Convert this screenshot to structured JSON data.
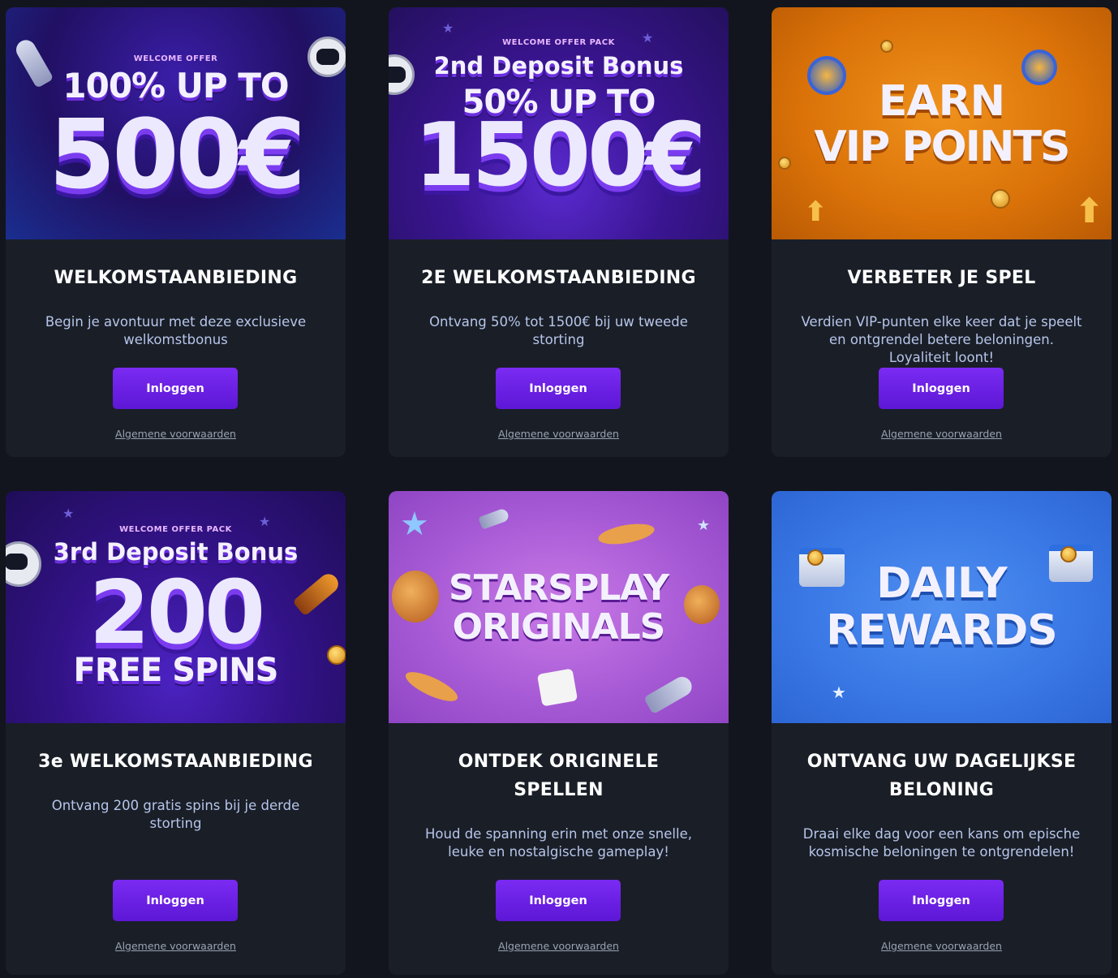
{
  "login_label": "Inloggen",
  "terms_label": "Algemene voorwaarden",
  "cards": [
    {
      "title": "WELKOMSTAANBIEDING",
      "description": "Begin je avontuur met deze exclusieve welkomstbonus",
      "banner": {
        "kicker": "WELCOME OFFER",
        "line1": "100% UP TO",
        "big": "500€"
      }
    },
    {
      "title": "2E WELKOMSTAANBIEDING",
      "description": "Ontvang 50% tot 1500€ bij uw tweede storting",
      "banner": {
        "kicker": "WELCOME OFFER PACK",
        "deposit": "2nd Deposit Bonus",
        "line1": "50% UP TO",
        "big": "1500€"
      }
    },
    {
      "title": "VERBETER JE SPEL",
      "description": "Verdien VIP-punten elke keer dat je speelt en ontgrendel betere beloningen. Loyaliteit loont!",
      "banner": {
        "line1": "EARN",
        "line2": "VIP POINTS"
      }
    },
    {
      "title": "3e WELKOMSTAANBIEDING",
      "description": "Ontvang 200 gratis spins bij je derde storting",
      "banner": {
        "kicker": "WELCOME OFFER PACK",
        "deposit": "3rd Deposit Bonus",
        "big": "200",
        "line2": "FREE SPINS"
      }
    },
    {
      "title": "ONTDEK ORIGINELE SPELLEN",
      "description": "Houd de spanning erin met onze snelle, leuke en nostalgische gameplay!",
      "banner": {
        "line1": "STARSPLAY",
        "line2": "ORIGINALS"
      }
    },
    {
      "title": "ONTVANG UW DAGELIJKSE BELONING",
      "description": "Draai elke dag voor een kans om epische kosmische beloningen te ontgrendelen!",
      "banner": {
        "line1": "DAILY",
        "line2": "REWARDS"
      }
    }
  ],
  "colors": {
    "page_bg": "#12151d",
    "card_bg": "#1a1e27",
    "button": "#6a20e6",
    "desc_text": "#b6c6ea",
    "vip_banner": "#e07a10",
    "originals_banner": "#b061d8",
    "rewards_banner": "#3a7ce8"
  }
}
